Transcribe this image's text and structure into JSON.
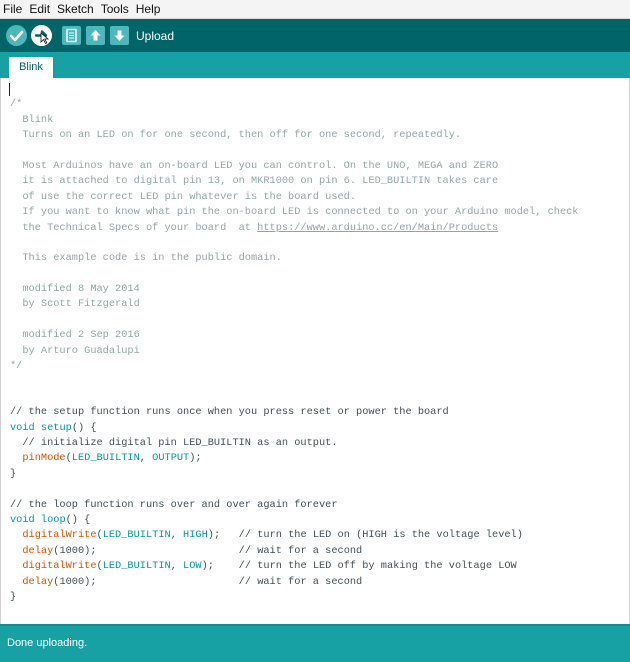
{
  "menu": [
    "File",
    "Edit",
    "Sketch",
    "Tools",
    "Help"
  ],
  "toolbar": {
    "label": "Upload",
    "buttons": [
      {
        "name": "verify",
        "icon": "checkmark-icon"
      },
      {
        "name": "upload",
        "icon": "arrow-right-icon"
      },
      {
        "name": "new",
        "icon": "new-file-icon"
      },
      {
        "name": "open",
        "icon": "arrow-up-icon"
      },
      {
        "name": "save",
        "icon": "arrow-down-icon"
      }
    ]
  },
  "tab": {
    "label": "Blink"
  },
  "code": {
    "lines": [
      "/*",
      "  Blink",
      "  Turns on an LED on for one second, then off for one second, repeatedly.",
      "",
      "  Most Arduinos have an on-board LED you can control. On the UNO, MEGA and ZERO",
      "  it is attached to digital pin 13, on MKR1000 on pin 6. LED_BUILTIN takes care",
      "  of use the correct LED pin whatever is the board used.",
      "  If you want to know what pin the on-board LED is connected to on your Arduino model, check",
      "  the Technical Specs of your board  at ",
      "",
      "  This example code is in the public domain.",
      "",
      "  modified 8 May 2014",
      "  by Scott Fitzgerald",
      "",
      "  modified 2 Sep 2016",
      "  by Arturo Guadalupi",
      "*/",
      "",
      "",
      "// the setup function runs once when you press reset or power the board",
      "",
      "  // initialize digital pin LED_BUILTIN as an output.",
      "",
      "}",
      "",
      "// the loop function runs over and over again forever",
      "",
      "",
      "",
      "",
      "",
      "}"
    ],
    "url": "https://www.arduino.cc/en/Main/Products",
    "setup": {
      "type": "void",
      "name": "setup",
      "rest": "() {"
    },
    "pinmode": {
      "fn": "pinMode",
      "open": "(",
      "arg1": "LED_BUILTIN",
      "sep": ", ",
      "arg2": "OUTPUT",
      "close": ");"
    },
    "loop": {
      "type": "void",
      "name": "loop",
      "rest": "() {"
    },
    "dw1": {
      "fn": "digitalWrite",
      "open": "(",
      "arg1": "LED_BUILTIN",
      "sep": ", ",
      "arg2": "HIGH",
      "close": ");",
      "pad": "   ",
      "comment": "// turn the LED on (HIGH is the voltage level)"
    },
    "d1": {
      "fn": "delay",
      "args": "(1000);",
      "pad": "                       ",
      "comment": "// wait for a second"
    },
    "dw2": {
      "fn": "digitalWrite",
      "open": "(",
      "arg1": "LED_BUILTIN",
      "sep": ", ",
      "arg2": "LOW",
      "close": ");",
      "pad": "    ",
      "comment": "// turn the LED off by making the voltage LOW"
    },
    "d2": {
      "fn": "delay",
      "args": "(1000);",
      "pad": "                       ",
      "comment": "// wait for a second"
    }
  },
  "status": {
    "text": "Done uploading."
  },
  "colors": {
    "toolbar": "#006468",
    "tabbar": "#17a1a5",
    "status": "#17a1a5",
    "keyword": "#00979c",
    "function": "#d35400",
    "comment": "#95a5a6"
  }
}
